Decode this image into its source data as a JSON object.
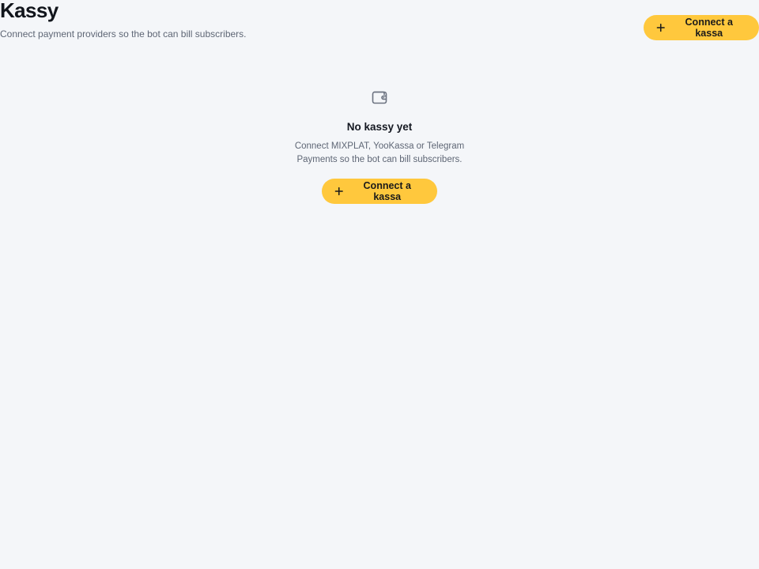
{
  "header": {
    "title": "Kassy",
    "subtitle": "Connect payment providers so the bot can bill subscribers.",
    "connect_button_label": "Connect a kassa"
  },
  "empty_state": {
    "icon": "wallet-icon",
    "title": "No kassy yet",
    "description_line1": "Connect MIXPLAT, YooKassa or Telegram",
    "description_line2": "Payments so the bot can bill subscribers.",
    "connect_button_label": "Connect a kassa"
  },
  "colors": {
    "background": "#f4f6f9",
    "accent": "#ffc83d",
    "text_primary": "#141821",
    "text_secondary": "#5e6675"
  }
}
